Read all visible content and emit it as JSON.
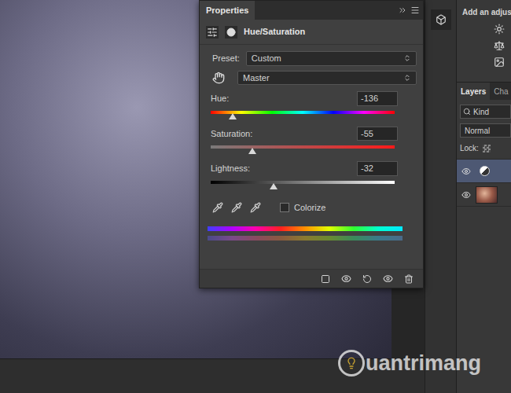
{
  "properties_panel": {
    "tab": "Properties",
    "adjustment": "Hue/Saturation",
    "preset": {
      "label": "Preset:",
      "value": "Custom"
    },
    "channel": "Master",
    "sliders": [
      {
        "label": "Hue",
        "value": "-136",
        "level": 0.12,
        "kind": "hue"
      },
      {
        "label": "Saturation",
        "value": "-55",
        "level": 0.225,
        "kind": "saturation"
      },
      {
        "label": "Lightness",
        "value": "-32",
        "level": 0.34,
        "kind": "lightness"
      }
    ],
    "colorize": {
      "label": "Colorize",
      "checked": false
    }
  },
  "adjustments_panel": {
    "title": "Add an adjus"
  },
  "layers_panel": {
    "tabs": [
      {
        "label": "Layers",
        "selected": true
      },
      {
        "label": "Cha",
        "selected": false
      }
    ],
    "filter": "Kind",
    "blend_mode": "Normal",
    "lock_label": "Lock:",
    "layers": [
      {
        "kind": "adjustment",
        "selected": true,
        "visible": true
      },
      {
        "kind": "image",
        "selected": false,
        "visible": true
      }
    ]
  },
  "watermark": "uantrimang"
}
